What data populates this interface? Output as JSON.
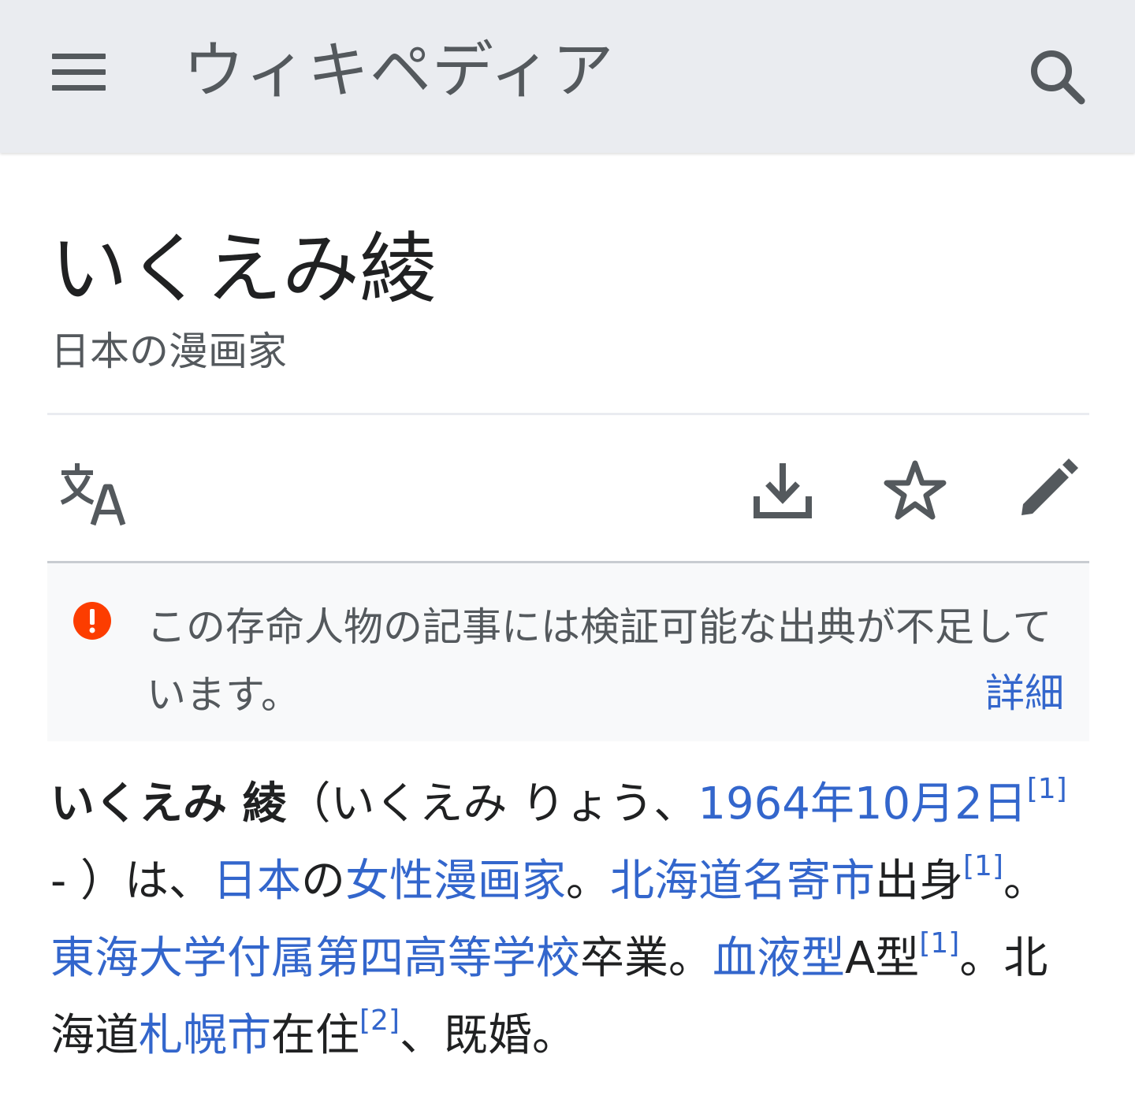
{
  "header": {
    "brand": "ウィキペディア"
  },
  "page": {
    "title": "いくえみ綾",
    "subtitle": "日本の漫画家"
  },
  "notice": {
    "text": "この存命人物の記事には検証可能な出典が不足しています。",
    "more_label": "詳細"
  },
  "article": {
    "segments": [
      {
        "text": "いくえみ 綾",
        "style": "bold"
      },
      {
        "text": "（いくえみ りょう、",
        "style": "plain"
      },
      {
        "text": "1964年10月2日",
        "style": "link"
      },
      {
        "text": "[1]",
        "style": "ref"
      },
      {
        "text": " - ）は、",
        "style": "plain"
      },
      {
        "text": "日本",
        "style": "link"
      },
      {
        "text": "の",
        "style": "plain"
      },
      {
        "text": "女性",
        "style": "link"
      },
      {
        "text": "漫画家",
        "style": "link"
      },
      {
        "text": "。",
        "style": "plain"
      },
      {
        "text": "北海道",
        "style": "link"
      },
      {
        "text": "名寄市",
        "style": "link"
      },
      {
        "text": "出身",
        "style": "plain"
      },
      {
        "text": "[1]",
        "style": "ref"
      },
      {
        "text": "。",
        "style": "plain"
      },
      {
        "text": "東海大学付属第四高等学校",
        "style": "link"
      },
      {
        "text": "卒業。",
        "style": "plain"
      },
      {
        "text": "血液型",
        "style": "link"
      },
      {
        "text": "A型",
        "style": "plain"
      },
      {
        "text": "[1]",
        "style": "ref"
      },
      {
        "text": "。北海道",
        "style": "plain"
      },
      {
        "text": "札幌市",
        "style": "link"
      },
      {
        "text": "在住",
        "style": "plain"
      },
      {
        "text": "[2]",
        "style": "ref"
      },
      {
        "text": "、既婚。",
        "style": "plain"
      }
    ]
  },
  "icons": {
    "menu": "menu-icon",
    "search": "search-icon",
    "language": "language-icon",
    "download": "download-icon",
    "star": "star-icon",
    "edit": "edit-pencil-icon",
    "notice": "warning-icon"
  },
  "colors": {
    "header_bg": "#eaecf0",
    "link": "#3366cc",
    "text": "#202122",
    "muted": "#54595d",
    "warning": "#fc3d00",
    "notice_bg": "#f8f9fa"
  }
}
